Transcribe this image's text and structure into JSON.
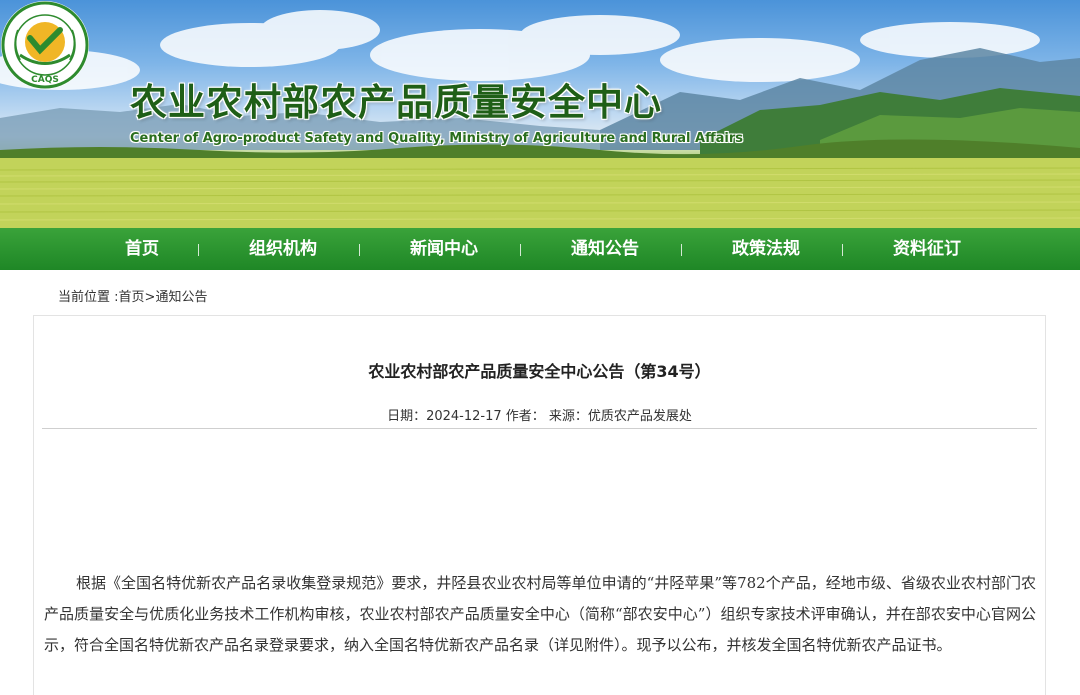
{
  "header": {
    "title": "农业农村部农产品质量安全中心",
    "subtitle": "Center of Agro-product Safety and Quality, Ministry of Agriculture and Rural Affairs",
    "logo_text": "CAQS"
  },
  "nav": {
    "items": [
      {
        "label": "首页"
      },
      {
        "label": "组织机构"
      },
      {
        "label": "新闻中心"
      },
      {
        "label": "通知公告"
      },
      {
        "label": "政策法规"
      },
      {
        "label": "资料征订"
      }
    ]
  },
  "breadcrumb": {
    "prefix": "当前位置 :",
    "home": "首页",
    "separator": ">",
    "current": "通知公告"
  },
  "article": {
    "title": "农业农村部农产品质量安全中心公告（第34号）",
    "meta": "日期：2024-12-17 作者： 来源：优质农产品发展处",
    "body": "根据《全国名特优新农产品名录收集登录规范》要求，井陉县农业农村局等单位申请的“井陉苹果”等782个产品，经地市级、省级农业农村部门农产品质量安全与优质化业务技术工作机构审核，农业农村部农产品质量安全中心（简称“部农安中心”）组织专家技术评审确认，并在部农安中心官网公示，符合全国名特优新农产品名录登录要求，纳入全国名特优新农产品名录（详见附件）。现予以公布，并核发全国名特优新农产品证书。"
  },
  "colors": {
    "nav_green": "#2c9530",
    "title_green": "#1f5f17"
  }
}
